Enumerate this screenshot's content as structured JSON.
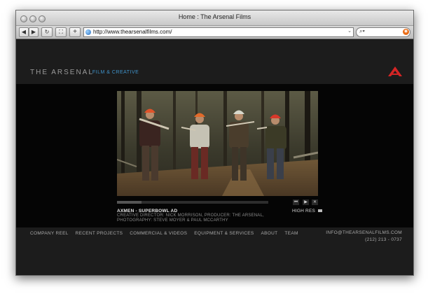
{
  "window": {
    "title": "Home : The Arsenal Films"
  },
  "toolbar": {
    "url": "http://www.thearsenalfilms.com/"
  },
  "header": {
    "logo": "THE ARSENAL",
    "tagline": "FILM & CREATIVE",
    "brand_color": "#d42525"
  },
  "player": {
    "title": "AXMEN - SUPERBOWL AD",
    "credits": "CREATIVE DIRECTOR: NICK MORRISON, PRODUCER: THE ARSENAL, PHOTOGRAPHY: STEVE MOYER & PAUL MCCARTHY",
    "hi_res_label": "HIGH RES",
    "progress": 0.16
  },
  "footer": {
    "nav": [
      "COMPANY REEL",
      "RECENT PROJECTS",
      "COMMERCIAL & VIDEOS",
      "EQUIPMENT & SERVICES",
      "ABOUT",
      "TEAM"
    ],
    "email": "INFO@THEARSENALFILMS.COM",
    "phone": "(212) 213 - 0737"
  },
  "colors": {
    "accent_blue": "#3f92c9",
    "page_bg": "#121212"
  }
}
